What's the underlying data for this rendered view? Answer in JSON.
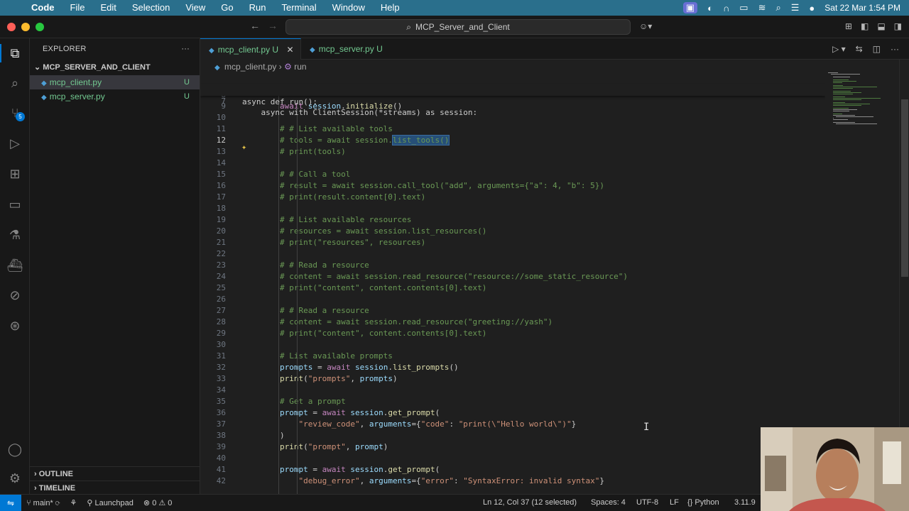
{
  "menubar": {
    "app": "Code",
    "items": [
      "File",
      "Edit",
      "Selection",
      "View",
      "Go",
      "Run",
      "Terminal",
      "Window",
      "Help"
    ],
    "datetime": "Sat 22 Mar  1:54 PM"
  },
  "titlebar": {
    "search": "MCP_Server_and_Client"
  },
  "sidebar": {
    "title": "EXPLORER",
    "folder": "MCP_SERVER_AND_CLIENT",
    "files": [
      {
        "name": "mcp_client.py",
        "status": "U"
      },
      {
        "name": "mcp_server.py",
        "status": "U"
      }
    ],
    "outline": "OUTLINE",
    "timeline": "TIMELINE",
    "scm_badge": "5"
  },
  "tabs": [
    {
      "name": "mcp_client.py",
      "status": "U"
    },
    {
      "name": "mcp_server.py",
      "status": "U"
    }
  ],
  "breadcrumb": {
    "file": "mcp_client.py",
    "symbol": "run"
  },
  "editor": {
    "sticky": [
      {
        "n": "5",
        "text": "async def run():"
      },
      {
        "n": "7",
        "text": "    async with ClientSession(*streams) as session:"
      }
    ],
    "lines": [
      {
        "n": "8",
        "text": ""
      },
      {
        "n": "9",
        "text": "        await session.initialize()"
      },
      {
        "n": "10",
        "text": ""
      },
      {
        "n": "11",
        "text": "        # # List available tools"
      },
      {
        "n": "12",
        "text": "        # tools = await session.list_tools()"
      },
      {
        "n": "13",
        "text": "        # print(tools)"
      },
      {
        "n": "14",
        "text": ""
      },
      {
        "n": "15",
        "text": "        # # Call a tool"
      },
      {
        "n": "16",
        "text": "        # result = await session.call_tool(\"add\", arguments={\"a\": 4, \"b\": 5})"
      },
      {
        "n": "17",
        "text": "        # print(result.content[0].text)"
      },
      {
        "n": "18",
        "text": ""
      },
      {
        "n": "19",
        "text": "        # # List available resources"
      },
      {
        "n": "20",
        "text": "        # resources = await session.list_resources()"
      },
      {
        "n": "21",
        "text": "        # print(\"resources\", resources)"
      },
      {
        "n": "22",
        "text": ""
      },
      {
        "n": "23",
        "text": "        # # Read a resource"
      },
      {
        "n": "24",
        "text": "        # content = await session.read_resource(\"resource://some_static_resource\")"
      },
      {
        "n": "25",
        "text": "        # print(\"content\", content.contents[0].text)"
      },
      {
        "n": "26",
        "text": ""
      },
      {
        "n": "27",
        "text": "        # # Read a resource"
      },
      {
        "n": "28",
        "text": "        # content = await session.read_resource(\"greeting://yash\")"
      },
      {
        "n": "29",
        "text": "        # print(\"content\", content.contents[0].text)"
      },
      {
        "n": "30",
        "text": ""
      },
      {
        "n": "31",
        "text": "        # List available prompts"
      },
      {
        "n": "32",
        "text": "        prompts = await session.list_prompts()"
      },
      {
        "n": "33",
        "text": "        print(\"prompts\", prompts)"
      },
      {
        "n": "34",
        "text": ""
      },
      {
        "n": "35",
        "text": "        # Get a prompt"
      },
      {
        "n": "36",
        "text": "        prompt = await session.get_prompt("
      },
      {
        "n": "37",
        "text": "            \"review_code\", arguments={\"code\": \"print(\\\"Hello world\\\")\"}"
      },
      {
        "n": "38",
        "text": "        )"
      },
      {
        "n": "39",
        "text": "        print(\"prompt\", prompt)"
      },
      {
        "n": "40",
        "text": ""
      },
      {
        "n": "41",
        "text": "        prompt = await session.get_prompt("
      },
      {
        "n": "42",
        "text": "            \"debug_error\", arguments={\"error\": \"SyntaxError: invalid syntax\"}"
      }
    ],
    "current_line": "12",
    "selection": "list_tools()"
  },
  "statusbar": {
    "branch": "main*",
    "launchpad": "Launchpad",
    "errors": "0",
    "warnings": "0",
    "position": "Ln 12, Col 37 (12 selected)",
    "spaces": "Spaces: 4",
    "encoding": "UTF-8",
    "eol": "LF",
    "language": "Python",
    "interpreter": "3.11.9"
  },
  "colors": {
    "accent": "#0078d4",
    "menubar": "#2a6f8c",
    "untracked": "#73c991"
  }
}
